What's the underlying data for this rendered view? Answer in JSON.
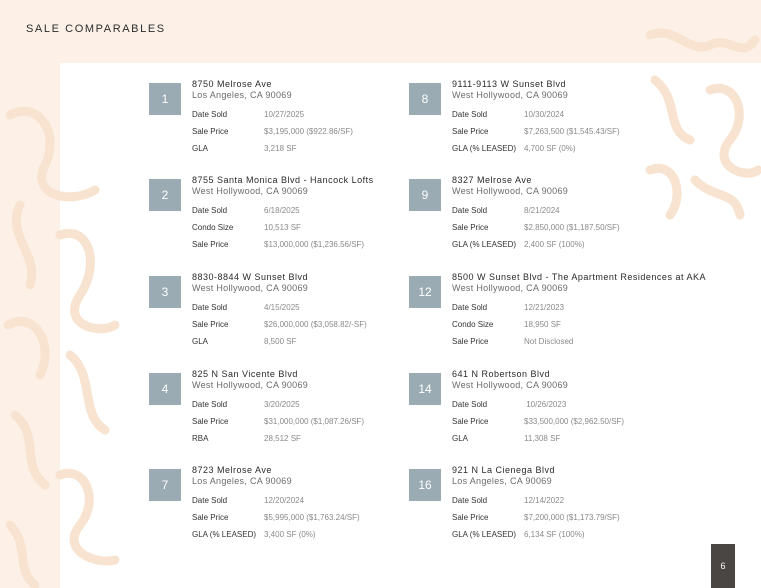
{
  "page": {
    "title": "SALE COMPARABLES",
    "page_number": "6"
  },
  "comps": [
    {
      "num": "1",
      "address": "8750 Melrose Ave",
      "city": "Los Angeles, CA 90069",
      "rows": [
        {
          "label": "Date Sold",
          "value": "10/27/2025"
        },
        {
          "label": "Sale Price",
          "value": "$3,195,000 ($922.86/SF)"
        },
        {
          "label": "GLA",
          "value": "3,218 SF"
        }
      ]
    },
    {
      "num": "8",
      "address": "9111-9113 W Sunset Blvd",
      "city": "West Hollywood, CA 90069",
      "rows": [
        {
          "label": "Date Sold",
          "value": "10/30/2024"
        },
        {
          "label": "Sale Price",
          "value": "$7,263,500 ($1,545.43/SF)"
        },
        {
          "label": "GLA (% LEASED)",
          "value": "4,700 SF (0%)"
        }
      ]
    },
    {
      "num": "2",
      "address": "8755 Santa Monica Blvd - Hancock Lofts",
      "city": "West Hollywood, CA 90069",
      "rows": [
        {
          "label": "Date Sold",
          "value": "6/18/2025"
        },
        {
          "label": "Condo Size",
          "value": "10,513 SF"
        },
        {
          "label": "Sale Price",
          "value": "$13,000,000 ($1,236.56/SF)"
        }
      ]
    },
    {
      "num": "9",
      "address": "8327 Melrose Ave",
      "city": "West Hollywood, CA 90069",
      "rows": [
        {
          "label": "Date Sold",
          "value": "8/21/2024"
        },
        {
          "label": "Sale Price",
          "value": "$2,850,000 ($1,187.50/SF)"
        },
        {
          "label": "GLA (% LEASED)",
          "value": "2,400 SF (100%)"
        }
      ]
    },
    {
      "num": "3",
      "address": "8830-8844 W Sunset Blvd",
      "city": "West Hollywood, CA 90069",
      "rows": [
        {
          "label": "Date Sold",
          "value": "4/15/2025"
        },
        {
          "label": "Sale Price",
          "value": "$26,000,000 ($3,058.82/-SF)"
        },
        {
          "label": "GLA",
          "value": "8,500 SF"
        }
      ]
    },
    {
      "num": "12",
      "address": "8500 W Sunset Blvd - The Apartment Residences at AKA",
      "city": "West Hollywood, CA 90069",
      "rows": [
        {
          "label": "Date Sold",
          "value": "12/21/2023"
        },
        {
          "label": "Condo Size",
          "value": "18,950 SF"
        },
        {
          "label": "Sale Price",
          "value": "Not Disclosed"
        }
      ]
    },
    {
      "num": "4",
      "address": "825 N San Vicente Blvd",
      "city": "West Hollywood, CA 90069",
      "rows": [
        {
          "label": "Date Sold",
          "value": "3/20/2025"
        },
        {
          "label": "Sale Price",
          "value": "$31,000,000 ($1,087.26/SF)"
        },
        {
          "label": "RBA",
          "value": "28,512 SF"
        }
      ]
    },
    {
      "num": "14",
      "address": "641 N Robertson Blvd",
      "city": "West Hollywood, CA 90069",
      "rows": [
        {
          "label": "Date Sold",
          "value": " 10/26/2023"
        },
        {
          "label": "Sale Price",
          "value": "$33,500,000 ($2,962.50/SF)"
        },
        {
          "label": "GLA",
          "value": "11,308 SF"
        }
      ]
    },
    {
      "num": "7",
      "address": "8723 Melrose Ave",
      "city": "Los Angeles, CA 90069",
      "rows": [
        {
          "label": "Date Sold",
          "value": "12/20/2024"
        },
        {
          "label": "Sale Price",
          "value": "$5,995,000 ($1,763.24/SF)"
        },
        {
          "label": "GLA (% LEASED)",
          "value": "3,400 SF (0%)"
        }
      ]
    },
    {
      "num": "16",
      "address": "921 N La Cienega Blvd",
      "city": "Los Angeles, CA 90069",
      "rows": [
        {
          "label": "Date Sold",
          "value": "12/14/2022"
        },
        {
          "label": "Sale Price",
          "value": "$7,200,000 ($1,173.79/SF)"
        },
        {
          "label": "GLA (% LEASED)",
          "value": "6,134 SF (100%)"
        }
      ]
    }
  ],
  "colors": {
    "background": "#fdf1e7",
    "number_box": "#9aabb3",
    "page_tab": "#4a4643",
    "pattern": "#f7e3d0"
  }
}
